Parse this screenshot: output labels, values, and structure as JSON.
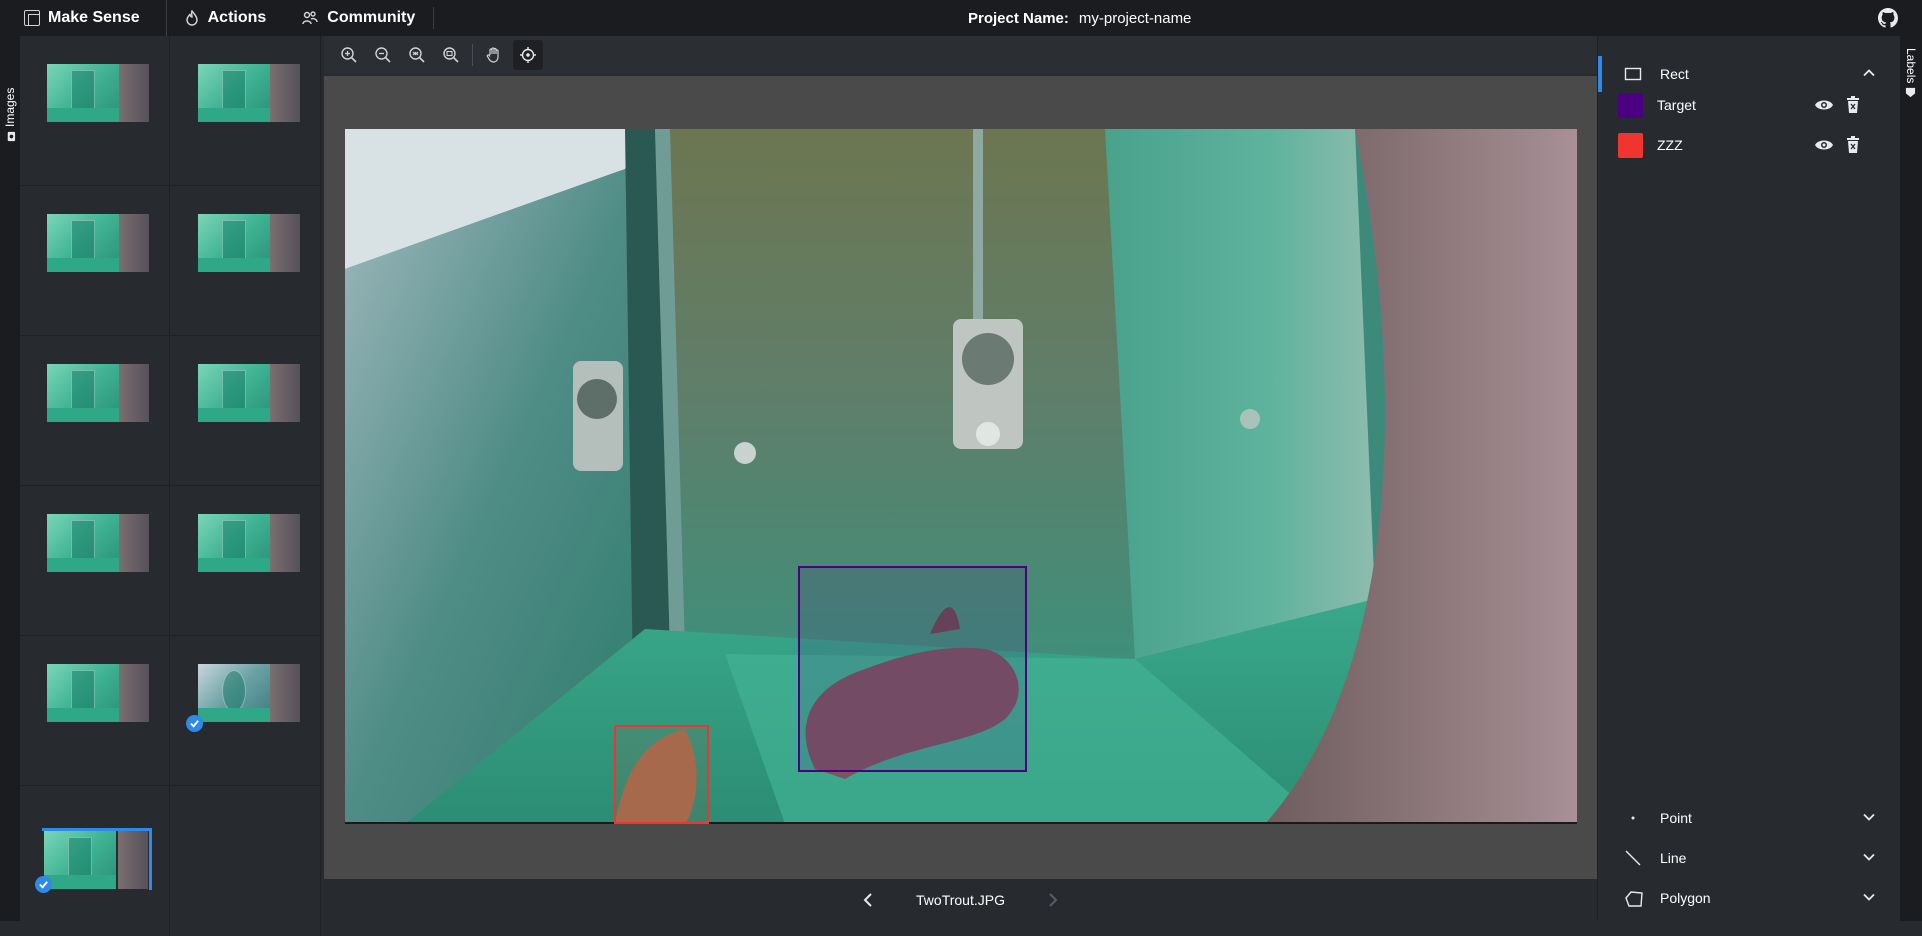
{
  "topbar": {
    "brand": "Make Sense",
    "menu": [
      {
        "label": "Actions",
        "icon": "flame-icon"
      },
      {
        "label": "Community",
        "icon": "people-icon"
      }
    ],
    "project_label": "Project Name:",
    "project_name": "my-project-name",
    "github_icon": "github-icon"
  },
  "left_tab": {
    "label": "Images"
  },
  "right_tab": {
    "label": "Labels"
  },
  "thumbnails": {
    "count": 11,
    "checked": [
      9,
      10
    ],
    "active": 10
  },
  "toolbar": {
    "tools": [
      "zoom-in-icon",
      "zoom-out-icon",
      "zoom-fit-icon",
      "zoom-max-icon",
      "pan-hand-icon",
      "crosshair-icon"
    ],
    "active_tool": "crosshair-icon"
  },
  "editor": {
    "file_name": "TwoTrout.JPG",
    "annotations": [
      {
        "label": "Target",
        "color": "#4b0082"
      },
      {
        "label": "ZZZ",
        "color": "#f0342f"
      }
    ]
  },
  "right_panel": {
    "sections": {
      "rect": {
        "title": "Rect",
        "expanded": true
      },
      "point": {
        "title": "Point",
        "expanded": false
      },
      "line": {
        "title": "Line",
        "expanded": false
      },
      "polygon": {
        "title": "Polygon",
        "expanded": false
      }
    },
    "labels": [
      {
        "name": "Target",
        "color": "#4b0082"
      },
      {
        "name": "ZZZ",
        "color": "#f0342f"
      }
    ]
  },
  "colors": {
    "accent": "#2e8ae6",
    "topbar": "#1a1c1f",
    "panel": "#272a2f",
    "canvas": "#4a4a4a"
  }
}
